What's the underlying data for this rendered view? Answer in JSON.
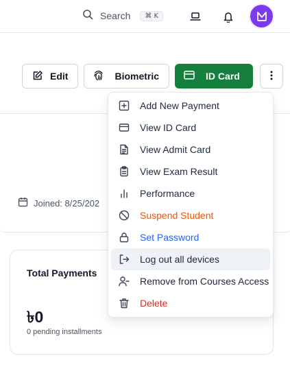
{
  "header": {
    "search_label": "Search",
    "search_shortcut": "⌘ K"
  },
  "actions": {
    "edit_label": "Edit",
    "biometric_label": "Biometric",
    "id_card_label": "ID Card"
  },
  "profile": {
    "joined_text": "Joined: 8/25/202"
  },
  "payments": {
    "title": "Total Payments",
    "amount": "৳0",
    "sub": "0 pending installments"
  },
  "menu": {
    "items": [
      {
        "label": "Add New Payment",
        "icon": "plus-square-icon"
      },
      {
        "label": "View ID Card",
        "icon": "card-icon"
      },
      {
        "label": "View Admit Card",
        "icon": "document-icon"
      },
      {
        "label": "View Exam Result",
        "icon": "clipboard-icon"
      },
      {
        "label": "Performance",
        "icon": "bar-chart-icon"
      },
      {
        "label": "Suspend Student",
        "icon": "ban-icon"
      },
      {
        "label": "Set Password",
        "icon": "lock-icon"
      },
      {
        "label": "Log out all devices",
        "icon": "logout-icon"
      },
      {
        "label": "Remove from Courses Access",
        "icon": "user-minus-icon"
      },
      {
        "label": "Delete",
        "icon": "trash-icon"
      }
    ]
  },
  "colors": {
    "primary": "#15803d",
    "avatar": "#7c3aed",
    "warning": "#ea580c",
    "info": "#2563eb",
    "danger": "#dc2626"
  }
}
